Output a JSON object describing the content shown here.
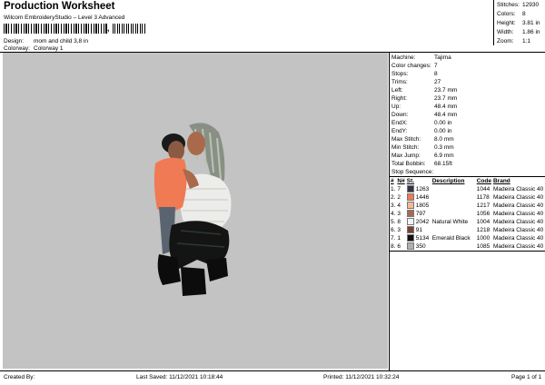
{
  "header": {
    "title": "Production Worksheet",
    "subtitle": "Wilcom EmbroideryStudio – Level 3 Advanced",
    "design_label": "Design:",
    "design_value": "mom and child 3,8 in",
    "colorway_label": "Colorway:",
    "colorway_value": "Colorway 1"
  },
  "stats": [
    {
      "label": "Stitches:",
      "value": "12930"
    },
    {
      "label": "Colors:",
      "value": "8"
    },
    {
      "label": "Height:",
      "value": "3.81 in"
    },
    {
      "label": "Width:",
      "value": "1.86 in"
    },
    {
      "label": "Zoom:",
      "value": "1:1"
    }
  ],
  "machine_info": [
    {
      "label": "Machine:",
      "value": "Tajima"
    },
    {
      "label": "Color changes:",
      "value": "7"
    },
    {
      "label": "Stops:",
      "value": "8"
    },
    {
      "label": "Trims:",
      "value": "27"
    },
    {
      "label": "Left:",
      "value": "23.7 mm"
    },
    {
      "label": "Right:",
      "value": "23.7 mm"
    },
    {
      "label": "Up:",
      "value": "48.4 mm"
    },
    {
      "label": "Down:",
      "value": "48.4 mm"
    },
    {
      "label": "EndX:",
      "value": "0.00 in"
    },
    {
      "label": "EndY:",
      "value": "0.00 in"
    },
    {
      "label": "Max Stitch:",
      "value": "8.0 mm"
    },
    {
      "label": "Min Stitch:",
      "value": "0.3 mm"
    },
    {
      "label": "Max Jump:",
      "value": "6.9 mm"
    },
    {
      "label": "Total Bobbin:",
      "value": "68.15ft"
    }
  ],
  "stop_sequence": {
    "title": "Stop Sequence:",
    "columns": [
      "#",
      "N#",
      "St.",
      "Description",
      "Code",
      "Brand"
    ],
    "rows": [
      {
        "n": "1.",
        "nn": "7",
        "color": "#3a3146",
        "st": "1263",
        "desc": "",
        "code": "1044",
        "brand": "Madeira Classic 40"
      },
      {
        "n": "2.",
        "nn": "2",
        "color": "#f07a55",
        "st": "1446",
        "desc": "",
        "code": "1178",
        "brand": "Madeira Classic 40"
      },
      {
        "n": "3.",
        "nn": "4",
        "color": "#f2b89a",
        "st": "1805",
        "desc": "",
        "code": "1217",
        "brand": "Madeira Classic 40"
      },
      {
        "n": "4.",
        "nn": "3",
        "color": "#a86a4a",
        "st": "797",
        "desc": "",
        "code": "1056",
        "brand": "Madeira Classic 40"
      },
      {
        "n": "5.",
        "nn": "8",
        "color": "#f3f3f3",
        "st": "2042",
        "desc": "Natural White",
        "code": "1004",
        "brand": "Madeira Classic 40"
      },
      {
        "n": "6.",
        "nn": "3",
        "color": "#7a4030",
        "st": "91",
        "desc": "",
        "code": "1218",
        "brand": "Madeira Classic 40"
      },
      {
        "n": "7.",
        "nn": "1",
        "color": "#111111",
        "st": "5134",
        "desc": "Emerald Black",
        "code": "1000",
        "brand": "Madeira Classic 40"
      },
      {
        "n": "8.",
        "nn": "6",
        "color": "#b0b0b0",
        "st": "350",
        "desc": "",
        "code": "1085",
        "brand": "Madeira Classic 40"
      }
    ]
  },
  "footer": {
    "created_by": "Created By:",
    "last_saved": "Last Saved: 11/12/2021 10:18:44",
    "printed": "Printed: 11/12/2021 10:32:24",
    "page": "Page 1 of 1"
  }
}
